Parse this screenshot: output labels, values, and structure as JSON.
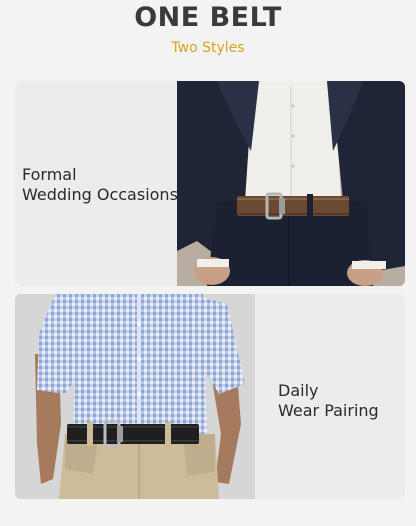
{
  "header": {
    "title": "ONE BELT",
    "subtitle": "Two Styles"
  },
  "cards": [
    {
      "caption_line1": "Formal",
      "caption_line2": "Wedding Occasions",
      "photo": "formal-suit-brown-belt"
    },
    {
      "caption_line1": "Daily",
      "caption_line2": "Wear Pairing",
      "photo": "casual-shirt-black-belt"
    }
  ],
  "colors": {
    "title": "#3a3a3a",
    "subtitle": "#d9a21b",
    "card_bg": "#ececec",
    "page_bg": "#f3f3f3"
  }
}
